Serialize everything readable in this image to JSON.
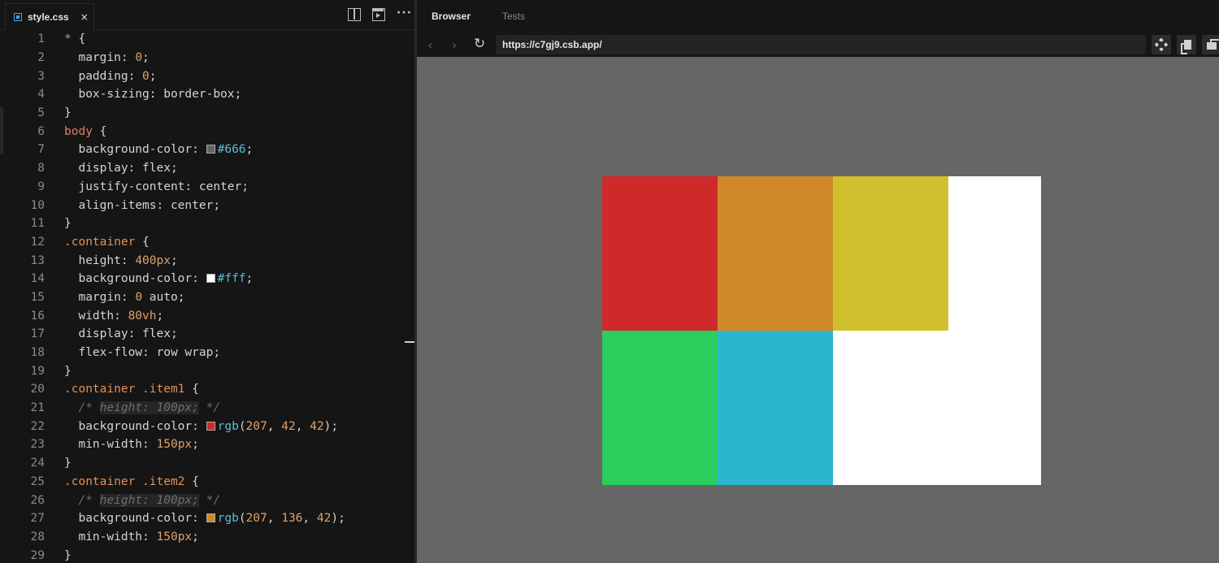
{
  "editor": {
    "tab_label": "style.css",
    "close_glyph": "×",
    "more_glyph": "···",
    "lines": [
      {
        "n": "1",
        "t": [
          [
            "c-sel",
            "* "
          ],
          [
            "c-prop",
            "{"
          ]
        ]
      },
      {
        "n": "2",
        "t": [
          [
            "c-prop",
            "  margin: "
          ],
          [
            "c-num",
            "0"
          ],
          [
            "c-prop",
            ";"
          ]
        ]
      },
      {
        "n": "3",
        "t": [
          [
            "c-prop",
            "  padding: "
          ],
          [
            "c-num",
            "0"
          ],
          [
            "c-prop",
            ";"
          ]
        ]
      },
      {
        "n": "4",
        "t": [
          [
            "c-prop",
            "  box-sizing: border-box;"
          ]
        ]
      },
      {
        "n": "5",
        "t": [
          [
            "c-prop",
            "}"
          ]
        ]
      },
      {
        "n": "6",
        "t": [
          [
            "c-body",
            "body "
          ],
          [
            "c-prop",
            "{"
          ]
        ]
      },
      {
        "n": "7",
        "t": [
          [
            "c-prop",
            "  background-color: "
          ],
          [
            "swatch",
            "#666666"
          ],
          [
            "c-hex",
            "#666"
          ],
          [
            "c-prop",
            ";"
          ]
        ]
      },
      {
        "n": "8",
        "t": [
          [
            "c-prop",
            "  display: flex;"
          ]
        ]
      },
      {
        "n": "9",
        "t": [
          [
            "c-prop",
            "  justify-content: center;"
          ]
        ]
      },
      {
        "n": "10",
        "t": [
          [
            "c-prop",
            "  align-items: center;"
          ]
        ]
      },
      {
        "n": "11",
        "t": [
          [
            "c-prop",
            "}"
          ]
        ]
      },
      {
        "n": "12",
        "t": [
          [
            "c-sel",
            ".container "
          ],
          [
            "c-prop",
            "{"
          ]
        ]
      },
      {
        "n": "13",
        "t": [
          [
            "c-prop",
            "  height: "
          ],
          [
            "c-num",
            "400px"
          ],
          [
            "c-prop",
            ";"
          ]
        ]
      },
      {
        "n": "14",
        "t": [
          [
            "c-prop",
            "  background-color: "
          ],
          [
            "swatch",
            "#ffffff"
          ],
          [
            "c-hex",
            "#fff"
          ],
          [
            "c-prop",
            ";"
          ]
        ]
      },
      {
        "n": "15",
        "t": [
          [
            "c-prop",
            "  margin: "
          ],
          [
            "c-num",
            "0"
          ],
          [
            "c-prop",
            " auto;"
          ]
        ]
      },
      {
        "n": "16",
        "t": [
          [
            "c-prop",
            "  width: "
          ],
          [
            "c-num",
            "80vh"
          ],
          [
            "c-prop",
            ";"
          ]
        ]
      },
      {
        "n": "17",
        "t": [
          [
            "c-prop",
            "  display: flex;"
          ]
        ]
      },
      {
        "n": "18",
        "t": [
          [
            "c-prop",
            "  flex-flow: row wrap;"
          ]
        ]
      },
      {
        "n": "19",
        "t": [
          [
            "c-prop",
            "}"
          ]
        ]
      },
      {
        "n": "20",
        "t": [
          [
            "c-sel",
            ".container .item1 "
          ],
          [
            "c-prop",
            "{"
          ]
        ]
      },
      {
        "n": "21",
        "t": [
          [
            "c-com",
            "  /* "
          ],
          [
            "c-com-bg",
            "height: 100px;"
          ],
          [
            "c-com",
            " */"
          ]
        ]
      },
      {
        "n": "22",
        "t": [
          [
            "c-prop",
            "  background-color: "
          ],
          [
            "swatch",
            "#cf2a2a"
          ],
          [
            "c-fn",
            "rgb"
          ],
          [
            "c-prop",
            "("
          ],
          [
            "c-num",
            "207"
          ],
          [
            "c-prop",
            ", "
          ],
          [
            "c-num",
            "42"
          ],
          [
            "c-prop",
            ", "
          ],
          [
            "c-num",
            "42"
          ],
          [
            "c-prop",
            ");"
          ]
        ]
      },
      {
        "n": "23",
        "t": [
          [
            "c-prop",
            "  min-width: "
          ],
          [
            "c-num",
            "150px"
          ],
          [
            "c-prop",
            ";"
          ]
        ]
      },
      {
        "n": "24",
        "t": [
          [
            "c-prop",
            "}"
          ]
        ]
      },
      {
        "n": "25",
        "t": [
          [
            "c-sel",
            ".container .item2 "
          ],
          [
            "c-prop",
            "{"
          ]
        ]
      },
      {
        "n": "26",
        "t": [
          [
            "c-com",
            "  /* "
          ],
          [
            "c-com-bg",
            "height: 100px;"
          ],
          [
            "c-com",
            " */"
          ]
        ]
      },
      {
        "n": "27",
        "t": [
          [
            "c-prop",
            "  background-color: "
          ],
          [
            "swatch",
            "#cf882a"
          ],
          [
            "c-fn",
            "rgb"
          ],
          [
            "c-prop",
            "("
          ],
          [
            "c-num",
            "207"
          ],
          [
            "c-prop",
            ", "
          ],
          [
            "c-num",
            "136"
          ],
          [
            "c-prop",
            ", "
          ],
          [
            "c-num",
            "42"
          ],
          [
            "c-prop",
            ");"
          ]
        ]
      },
      {
        "n": "28",
        "t": [
          [
            "c-prop",
            "  min-width: "
          ],
          [
            "c-num",
            "150px"
          ],
          [
            "c-prop",
            ";"
          ]
        ]
      },
      {
        "n": "29",
        "t": [
          [
            "c-prop",
            "}"
          ]
        ]
      }
    ]
  },
  "browser": {
    "tabs": {
      "active": "Browser",
      "inactive": "Tests"
    },
    "nav": {
      "back": "‹",
      "forward": "›",
      "reload": "↻"
    },
    "url": "https://c7gj9.csb.app/"
  },
  "preview": {
    "container_color": "#ffffff",
    "items": [
      {
        "name": "item1",
        "color": "#cf2a2a"
      },
      {
        "name": "item2",
        "color": "#cf882a"
      },
      {
        "name": "item3",
        "color": "#d1c02e"
      },
      {
        "name": "item4",
        "color": "#2ace5c"
      },
      {
        "name": "item5",
        "color": "#2ab6cf"
      }
    ]
  }
}
